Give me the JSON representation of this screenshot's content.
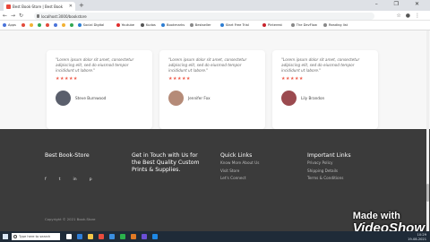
{
  "browser": {
    "tab_title": "Best Book-Store | Best Book",
    "url": "localhost:3000/bookstore",
    "bookmarks": [
      {
        "label": "Apps",
        "color": "#4a73d9"
      },
      {
        "label": "",
        "color": "#e24b3b"
      },
      {
        "label": "",
        "color": "#f2b233"
      },
      {
        "label": "",
        "color": "#31a853"
      },
      {
        "label": "",
        "color": "#e24b3b"
      },
      {
        "label": "",
        "color": "#4a73d9"
      },
      {
        "label": "",
        "color": "#f2b233"
      },
      {
        "label": "",
        "color": "#31a853"
      },
      {
        "label": "Social Digital",
        "color": "#2d7dd2"
      },
      {
        "label": "Youtube",
        "color": "#e02c2c"
      },
      {
        "label": "Kudos",
        "color": "#555555"
      },
      {
        "label": "Bookmarks",
        "color": "#2d7dd2"
      },
      {
        "label": "Bestseller",
        "color": "#888888"
      },
      {
        "label": "Start Free Trial",
        "color": "#2d7dd2"
      },
      {
        "label": "Pinterest",
        "color": "#c8232c"
      },
      {
        "label": "The DevFlow",
        "color": "#888888"
      },
      {
        "label": "Reading list",
        "color": "#888888"
      }
    ],
    "window_controls": "– ❐ ✕"
  },
  "testimonials": [
    {
      "quote": "\"Lorem ipsum dolor sit amet, consectetur adipiscing elit, sed do eiusmod tempor incididunt ut labore.\"",
      "stars": "★★★★★",
      "name": "Steve Burnwood"
    },
    {
      "quote": "\"Lorem ipsum dolor sit amet, consectetur adipiscing elit, sed do eiusmod tempor incididunt ut labore.\"",
      "stars": "★★★★★",
      "name": "Jennifer Fox"
    },
    {
      "quote": "\"Lorem ipsum dolor sit amet, consectetur adipiscing elit, sed do eiusmod tempor incididunt ut labore.\"",
      "stars": "★★★★★",
      "name": "Lily Brandon"
    }
  ],
  "footer": {
    "brand": "Best Book-Store",
    "social": [
      "f",
      "t",
      "in",
      "p"
    ],
    "contact_heading": "Get in Touch with Us for the Best Quality Custom Prints & Supplies.",
    "quick_links_heading": "Quick Links",
    "quick_links": [
      "Know More About Us",
      "Visit Store",
      "Let's Connect"
    ],
    "important_links_heading": "Important Links",
    "important_links": [
      "Privacy Policy",
      "Shipping Details",
      "Terms & Conditions"
    ],
    "copyright": "Copyright © 2021 Book-Store"
  },
  "watermark": {
    "line1": "Made with",
    "line2": "VideoShow"
  },
  "taskbar": {
    "search_placeholder": "Type here to search",
    "time": "10:29",
    "date": "19-08-2021"
  }
}
